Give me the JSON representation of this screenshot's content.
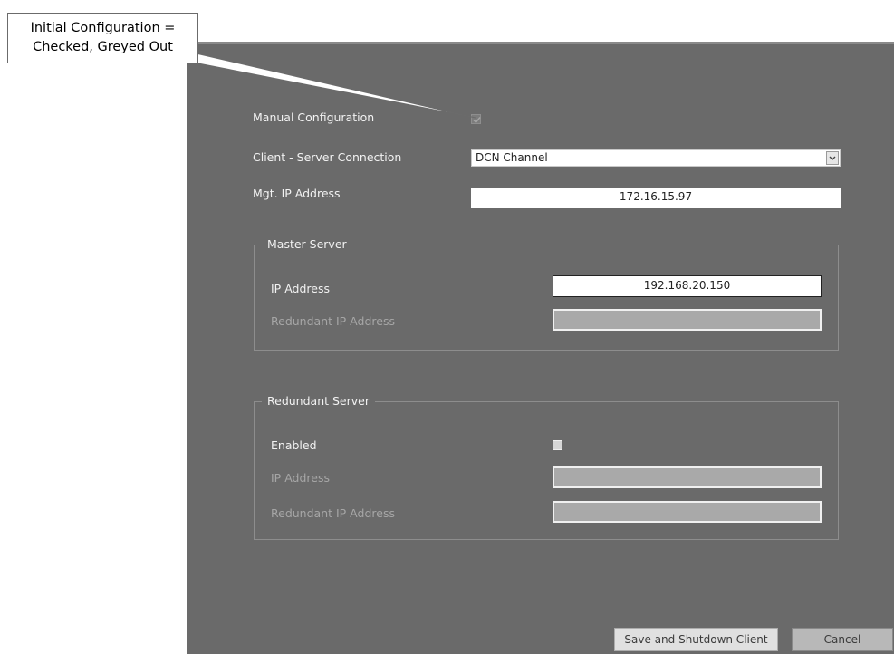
{
  "annotation": {
    "line1": "Initial Configuration =",
    "line2": "Checked, Greyed Out"
  },
  "form": {
    "manual_configuration_label": "Manual Configuration",
    "manual_configuration_checked": true,
    "client_server_label": "Client - Server Connection",
    "client_server_value": "DCN Channel",
    "mgt_ip_label": "Mgt. IP Address",
    "mgt_ip_value": "172.16.15.97"
  },
  "master_server": {
    "title": "Master Server",
    "ip_label": "IP Address",
    "ip_value": "192.168.20.150",
    "redundant_ip_label": "Redundant IP Address",
    "redundant_ip_value": ""
  },
  "redundant_server": {
    "title": "Redundant Server",
    "enabled_label": "Enabled",
    "enabled_checked": false,
    "ip_label": "IP Address",
    "ip_value": "",
    "redundant_ip_label": "Redundant IP Address",
    "redundant_ip_value": ""
  },
  "buttons": {
    "save_shutdown": "Save and Shutdown Client",
    "cancel": "Cancel"
  },
  "icons": {
    "checkmark": "checkmark-icon",
    "dropdown": "chevron-down-icon"
  }
}
